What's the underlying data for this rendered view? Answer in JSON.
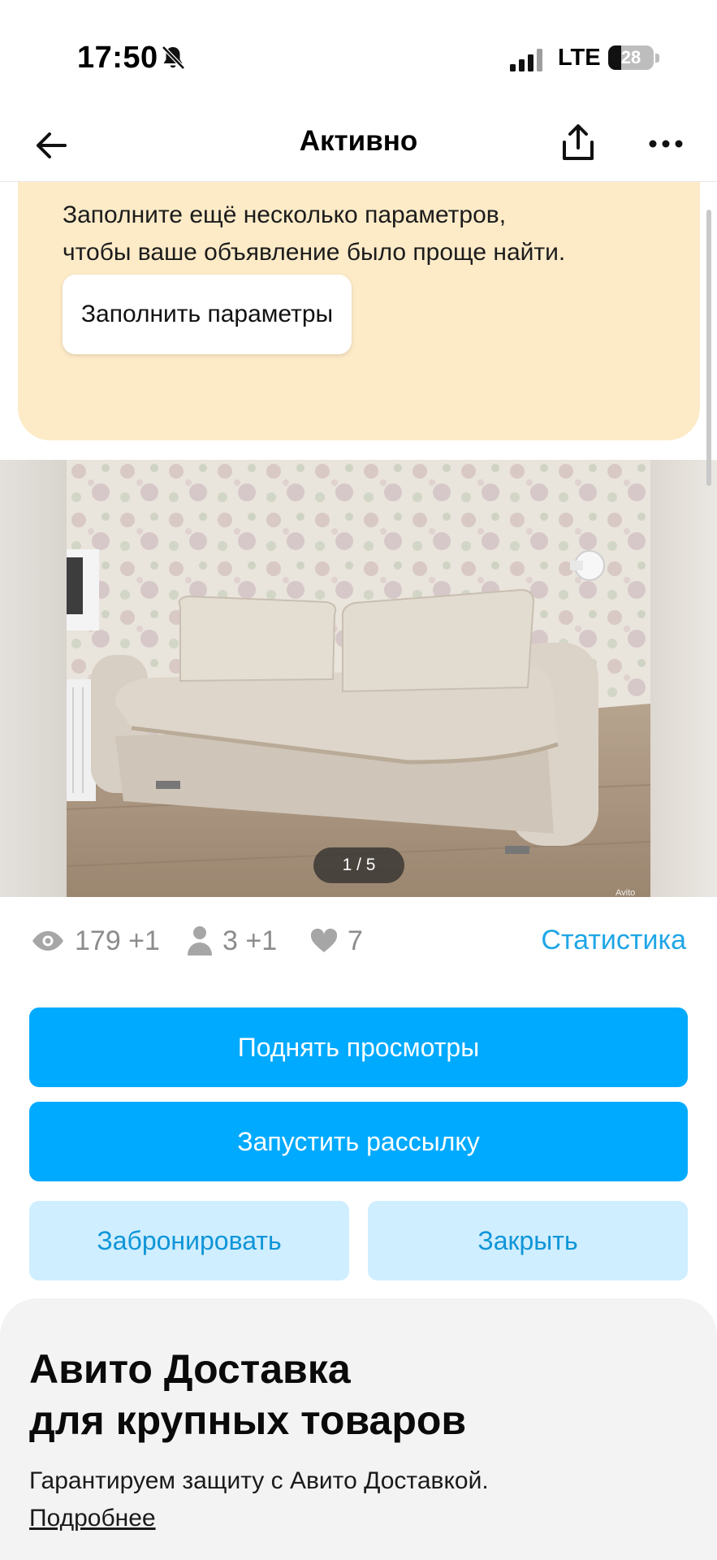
{
  "status_bar": {
    "time": "17:50",
    "network": "LTE",
    "battery": "28",
    "battery_level": 0.28
  },
  "nav": {
    "title": "Активно",
    "icons": [
      "back-arrow-icon",
      "share-icon",
      "more-icon"
    ]
  },
  "promo": {
    "text_line1": "Заполните ещё несколько параметров,",
    "text_line2": "чтобы ваше объявление было проще найти.",
    "button_label": "Заполнить параметры"
  },
  "gallery": {
    "counter": "1 / 5",
    "watermark": "Avito"
  },
  "stats": {
    "views": "179 +1",
    "contacts": "3 +1",
    "favorites": "7",
    "link_label": "Статистика"
  },
  "actions": {
    "raise_views": "Поднять просмотры",
    "start_mailing": "Запустить рассылку",
    "reserve": "Забронировать",
    "close": "Закрыть"
  },
  "delivery": {
    "title_line1": "Авито Доставка",
    "title_line2": "для крупных товаров",
    "text": "Гарантируем защиту с Авито Доставкой.",
    "link": "Подробнее"
  },
  "colors": {
    "accent": "#00aaff",
    "accent_light": "#cfeeff",
    "link": "#1fa6e6",
    "promo_bg": "#fdebc8"
  }
}
